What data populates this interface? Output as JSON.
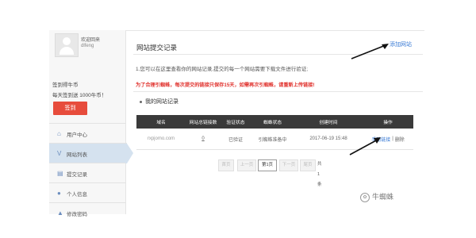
{
  "sidebar": {
    "welcome": "欢迎回来",
    "username": "dlfeng",
    "coins_label": "签到得牛币",
    "coins_daily": "每天签到送 1000牛币！",
    "signin_button": "签到",
    "items": [
      {
        "label": "用户中心",
        "icon": "home-icon"
      },
      {
        "label": "网站列表",
        "icon": "list-icon"
      },
      {
        "label": "提交记录",
        "icon": "records-icon"
      },
      {
        "label": "个人信息",
        "icon": "user-icon"
      },
      {
        "label": "修改密码",
        "icon": "lock-icon"
      }
    ],
    "active_index": 1
  },
  "main": {
    "title": "网站提交记录",
    "add_site": "添加网站",
    "notice": "1.您可以在这里查看你的网站记录,提交的每一个网站需要下载文件进行验证;",
    "warning": "为了合理引蜘蛛，每次提交的链接只保存15天，如需再次引蜘蛛，请重新上传链接!",
    "section_title": "我的网站记录"
  },
  "table": {
    "headers": [
      "域名",
      "网站总链接数",
      "验证状态",
      "蜘蛛状态",
      "创建时间",
      "操作"
    ],
    "rows": [
      {
        "domain": "rxpjomo.com",
        "links": "0",
        "verify": "已验证",
        "spider": "引蜘蛛准备中",
        "created": "2017-06-19 15:48",
        "op_upload": "手动链接",
        "op_sep": "|",
        "op_delete": "删除"
      }
    ]
  },
  "pager": {
    "first": "首页",
    "prev": "上一页",
    "current": "第1页",
    "next": "下一页",
    "last": "尾页",
    "total": "共1条"
  },
  "brand": "牛蜘蛛",
  "colors": {
    "accent": "#3a7bd5",
    "danger": "#e0302b",
    "button": "#e74c3c",
    "header": "#3a3a3a",
    "active_nav": "#d5e2ef"
  }
}
